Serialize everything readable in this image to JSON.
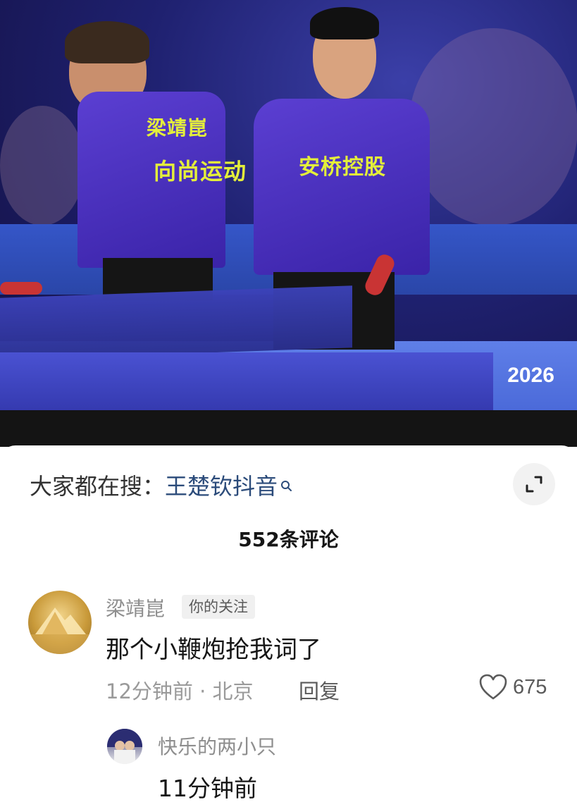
{
  "photo": {
    "description_icon": "table-tennis-photo",
    "shirt_texts": [
      "梁靖崑",
      "向尚运动",
      "安桥控股"
    ],
    "event_year": "2026"
  },
  "search_bar": {
    "prefix": "大家都在搜：",
    "keyword": "王楚钦抖音",
    "icon": "search-icon"
  },
  "comments": {
    "count_label": "552条评论",
    "items": [
      {
        "username": "梁靖崑",
        "badge": "你的关注",
        "text": "那个小鞭炮抢我词了",
        "time_location": "12分钟前 · 北京",
        "reply_label": "回复",
        "like_count": "675"
      }
    ],
    "sub_reply": {
      "username": "快乐的两小只",
      "time": "11分钟前"
    }
  },
  "colors": {
    "keyword": "#2b4b7a",
    "username": "#8e8e8e",
    "text": "#161616"
  }
}
